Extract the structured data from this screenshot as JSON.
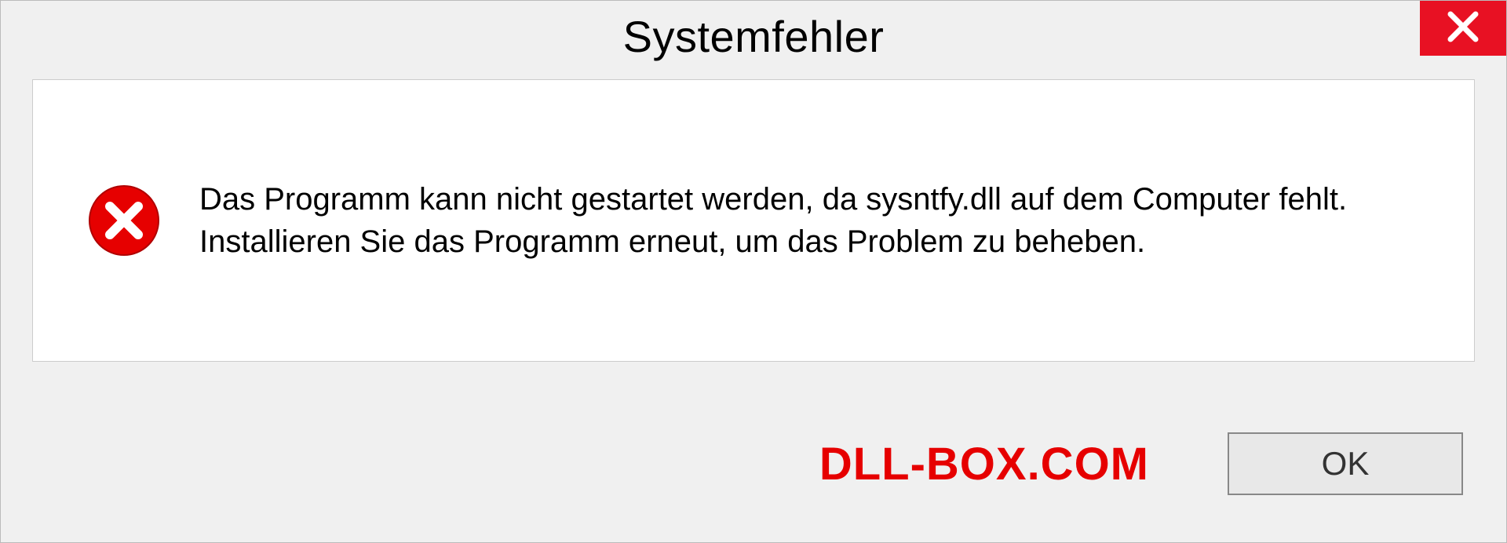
{
  "dialog": {
    "title": "Systemfehler",
    "message": "Das Programm kann nicht gestartet werden, da sysntfy.dll auf dem Computer fehlt. Installieren Sie das Programm erneut, um das Problem zu beheben.",
    "ok_label": "OK"
  },
  "watermark": "DLL-BOX.COM"
}
